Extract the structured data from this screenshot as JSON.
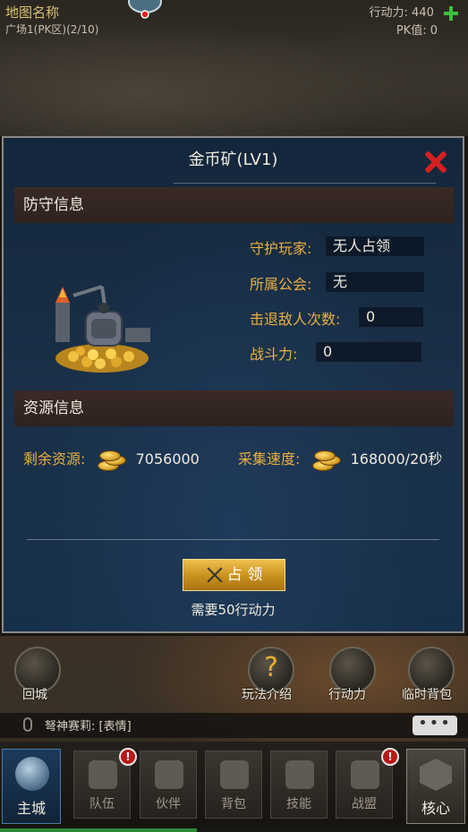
{
  "hud": {
    "map_name": "地图名称",
    "map_area": "广场1(PK区)(2/10)",
    "action_power": "行动力: 440",
    "pk_value": "PK值: 0"
  },
  "dialog": {
    "title": "金币矿(LV1)",
    "defense_section": "防守信息",
    "defense": {
      "guardian_label": "守护玩家:",
      "guardian_value": "无人占领",
      "guild_label": "所属公会:",
      "guild_value": "无",
      "repel_label": "击退敌人次数:",
      "repel_value": "0",
      "power_label": "战斗力:",
      "power_value": "0"
    },
    "resource_section": "资源信息",
    "resource": {
      "remaining_label": "剩余资源:",
      "remaining_value": "7056000",
      "speed_label": "采集速度:",
      "speed_value": "168000/20秒"
    },
    "occupy_button": "占 领",
    "need_text": "需要50行动力"
  },
  "bottom": {
    "return_city": "回城",
    "gameplay_intro": "玩法介绍",
    "action_power": "行动力",
    "temp_bag": "临时背包",
    "chat_text": "弩神赛莉: [表情]",
    "chat_more": "•••",
    "tabs": {
      "main_city": "主城",
      "team": "队伍",
      "partner": "伙伴",
      "bag": "背包",
      "skill": "技能",
      "alliance": "战盟",
      "core": "核心"
    },
    "badge": "!"
  },
  "colors": {
    "label_gold": "#e8b040",
    "close_red": "#d42020",
    "plus_green": "#3cc03c",
    "button_gold": "#c8901c"
  },
  "progress_fraction": 0.42
}
